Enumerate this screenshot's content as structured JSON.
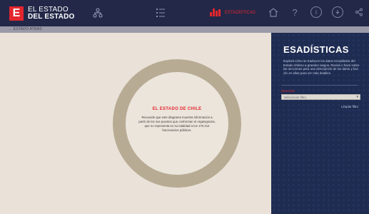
{
  "header": {
    "logo_letter": "E",
    "logo_line1": "EL ESTADO",
    "logo_line2": "DEL ESTADO",
    "active_section": "ESTADÍSTICAS",
    "colors": {
      "bar": "#232848",
      "accent": "#e4262d"
    },
    "nav_icons": [
      "org-chart-icon",
      "list-icon"
    ],
    "right_icons": [
      "home-icon",
      "help-icon",
      "info-icon",
      "download-icon",
      "share-icon"
    ]
  },
  "subnav": {
    "back_label": "← ESTADO ATRAS"
  },
  "diagram": {
    "title": "EL ESTADO DE CHILE",
    "text": "Recuerde que este diagrama muestra información a partir de los sus puestos que conforman el organigrama, que no representa en su totalidad a los 170.214 funcionarios públicos."
  },
  "panel": {
    "title": "ESADÍSTICAS",
    "description": "Explorá cómo se traducen los datos recopilados del Estado chileno a grandes rasgos. Revisá o hacé sobre las secciones para una descripción de los datos y haz clic en ellas para ver más detalles.",
    "field_label": "Dirección",
    "select_value": "Seleccione filtro",
    "clear_label": "Limpiar filtro",
    "colors": {
      "background": "#1e2c52"
    }
  }
}
